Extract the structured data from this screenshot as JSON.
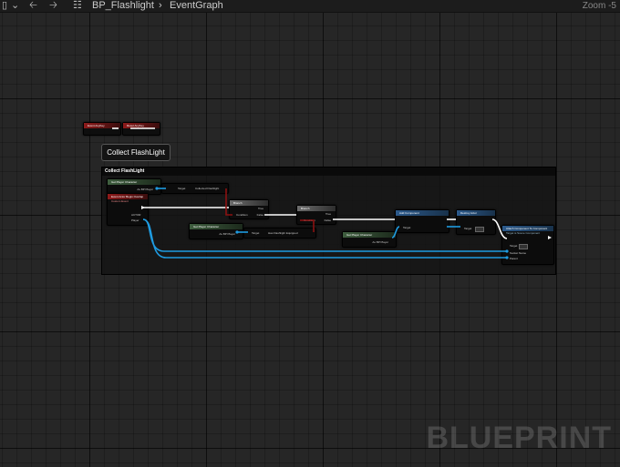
{
  "topbar": {
    "menu_icon": "▯",
    "menu_chevron": "⌄",
    "back_icon": "🡠",
    "forward_icon": "🡢",
    "graph_icon": "☷",
    "crumb_blueprint": "BP_Flashlight",
    "crumb_sep": "›",
    "crumb_graph": "EventGraph",
    "zoom": "Zoom -5"
  },
  "watermark": "BLUEPRINT",
  "comment": {
    "bubble": "Collect FlashLight",
    "box_title": "Collect FlashLight"
  },
  "nodes": {
    "small_event": "Event AnyKey",
    "small_func": "Reset AnyKey",
    "event_node": "Event Actor Begin Overlap",
    "event_sub": "Custom Event",
    "cast_node": "Cast to BP_Character",
    "get_player_top": "Get Player Character",
    "branch1": "Branch",
    "branch2": "Branch",
    "get_player_mid": "Get Player Character",
    "get_player_bot": "Get Player Character",
    "add_comp": "Add Component",
    "destroy": "Destroy Actor",
    "attach": "Attach Component To Component",
    "attach_sub": "Target is Scene Component"
  },
  "pins": {
    "as_player": "As BP Player",
    "target": "Target",
    "other_actor": "Other Actor",
    "actor": "ACTOR",
    "player": "Player",
    "condition": "Condition",
    "true": "True",
    "false": "False",
    "collected": "Collected Flashlight",
    "has_flashlight": "Has Flashlight Equipped",
    "target_val": "0.0",
    "parent": "Parent",
    "socket": "Socket Name"
  },
  "colors": {
    "exec": "#ffffff",
    "object": "#1f9be0",
    "bool": "#8b1111"
  }
}
